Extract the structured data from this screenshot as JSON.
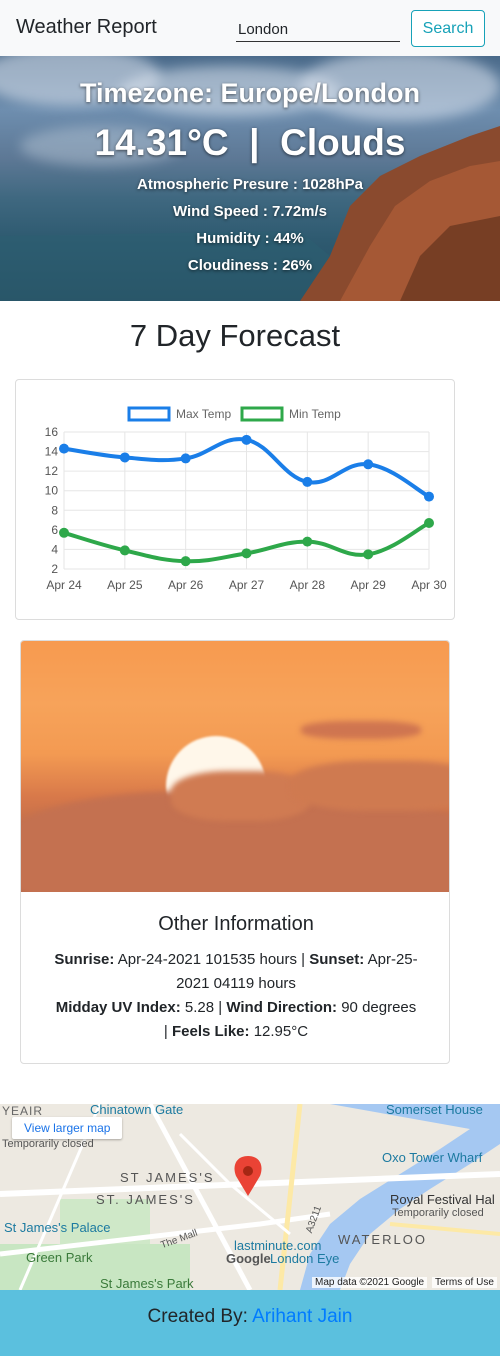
{
  "navbar": {
    "brand": "Weather Report",
    "search_value": "London",
    "search_button": "Search"
  },
  "hero": {
    "timezone": "Timezone: Europe/London",
    "temp_condition": "14.31°C  |  Clouds",
    "pressure": "Atmospheric Presure : 1028hPa",
    "wind_speed": "Wind Speed : 7.72m/s",
    "humidity": "Humidity : 44%",
    "cloudiness": "Cloudiness : 26%"
  },
  "forecast": {
    "title": "7 Day Forecast"
  },
  "chart_data": {
    "type": "line",
    "categories": [
      "Apr 24",
      "Apr 25",
      "Apr 26",
      "Apr 27",
      "Apr 28",
      "Apr 29",
      "Apr 30"
    ],
    "series": [
      {
        "name": "Max Temp",
        "values": [
          14.3,
          13.4,
          13.3,
          15.2,
          10.9,
          12.7,
          9.4
        ],
        "color": "#1a7ee8"
      },
      {
        "name": "Min Temp",
        "values": [
          5.7,
          3.9,
          2.8,
          3.6,
          4.8,
          3.5,
          6.7
        ],
        "color": "#2ea84a"
      }
    ],
    "yticks": [
      2,
      4,
      6,
      8,
      10,
      12,
      14,
      16
    ],
    "ylim": [
      2,
      16
    ],
    "grid": true,
    "legend": "top"
  },
  "other_info": {
    "title": "Other Information",
    "sunrise_label": "Sunrise:",
    "sunrise_value": "Apr-24-2021 101535 hours",
    "sunset_label": "Sunset:",
    "sunset_value": "Apr-25-2021 04119 hours",
    "uv_label": "Midday UV Index:",
    "uv_value": "5.28",
    "wind_dir_label": "Wind Direction:",
    "wind_dir_value": "90 degrees",
    "feels_like_label": "Feels Like:",
    "feels_like_value": "12.95°C"
  },
  "map": {
    "larger_map_link": "View larger map",
    "labels": {
      "chinatown": "Chinatown Gate",
      "somerset": "Somerset House",
      "temp_closed_1": "Temporarily closed",
      "oxo": "Oxo Tower Wharf",
      "st_james_1": "ST JAMES'S",
      "st_james_2": "ST. JAMES'S",
      "royal_festival": "Royal Festival Hal",
      "temp_closed_2": "Temporarily closed",
      "st_james_palace": "St James's Palace",
      "green_park": "Green Park",
      "the_mall": "The Mall",
      "lastminute": "lastminute.com",
      "london_eye": "London Eye",
      "waterloo": "WATERLOO",
      "a3211": "A3211",
      "google": "Google",
      "st_james_park": "St James's Park",
      "yeair": "YEAIR"
    },
    "map_data": "Map data ©2021 Google",
    "terms": "Terms of Use"
  },
  "footer": {
    "created_by": "Created By: ",
    "author": "Arihant Jain"
  }
}
